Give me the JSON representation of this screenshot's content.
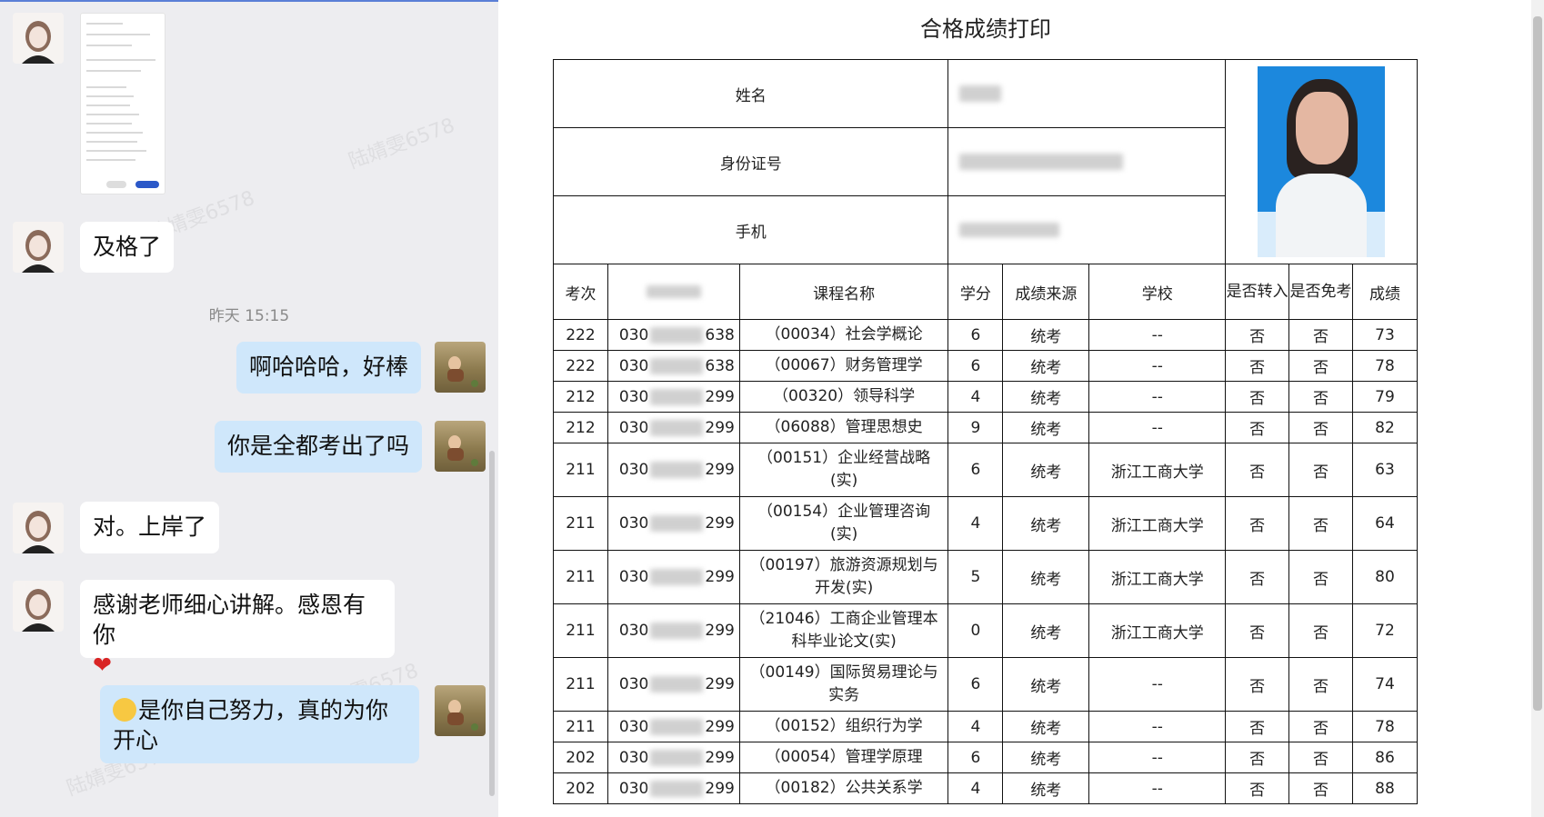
{
  "chat": {
    "timestamp": "昨天 15:15",
    "messages": [
      {
        "side": "in",
        "text": "及格了"
      },
      {
        "side": "out",
        "text": "啊哈哈哈，好棒"
      },
      {
        "side": "out",
        "text": "你是全都考出了吗"
      },
      {
        "side": "in",
        "text": "对。上岸了"
      },
      {
        "side": "in",
        "text": "感谢老师细心讲解。感恩有你",
        "emoji": "heart"
      },
      {
        "side": "out",
        "text": "是你自己努力，真的为你开心",
        "emoji": "wink"
      }
    ],
    "watermark": "陆婧雯6578"
  },
  "page": {
    "title": "合格成绩打印",
    "labels": {
      "name": "姓名",
      "id": "身份证号",
      "phone": "手机"
    },
    "headers": [
      "考次",
      "准考证号",
      "课程名称",
      "学分",
      "成绩来源",
      "学校",
      "是否转入",
      "是否免考",
      "成绩"
    ],
    "rows": [
      {
        "session": "222",
        "ticket_prefix": "030",
        "ticket_suffix": "638",
        "course": "（00034）社会学概论",
        "credit": "6",
        "source": "统考",
        "school": "--",
        "transfer": "否",
        "exempt": "否",
        "score": "73"
      },
      {
        "session": "222",
        "ticket_prefix": "030",
        "ticket_suffix": "638",
        "course": "（00067）财务管理学",
        "credit": "6",
        "source": "统考",
        "school": "--",
        "transfer": "否",
        "exempt": "否",
        "score": "78"
      },
      {
        "session": "212",
        "ticket_prefix": "030",
        "ticket_suffix": "299",
        "course": "（00320）领导科学",
        "credit": "4",
        "source": "统考",
        "school": "--",
        "transfer": "否",
        "exempt": "否",
        "score": "79"
      },
      {
        "session": "212",
        "ticket_prefix": "030",
        "ticket_suffix": "299",
        "course": "（06088）管理思想史",
        "credit": "9",
        "source": "统考",
        "school": "--",
        "transfer": "否",
        "exempt": "否",
        "score": "82"
      },
      {
        "session": "211",
        "ticket_prefix": "030",
        "ticket_suffix": "299",
        "course": "（00151）企业经营战略(实)",
        "credit": "6",
        "source": "统考",
        "school": "浙江工商大学",
        "transfer": "否",
        "exempt": "否",
        "score": "63"
      },
      {
        "session": "211",
        "ticket_prefix": "030",
        "ticket_suffix": "299",
        "course": "（00154）企业管理咨询(实)",
        "credit": "4",
        "source": "统考",
        "school": "浙江工商大学",
        "transfer": "否",
        "exempt": "否",
        "score": "64"
      },
      {
        "session": "211",
        "ticket_prefix": "030",
        "ticket_suffix": "299",
        "course": "（00197）旅游资源规划与开发(实)",
        "credit": "5",
        "source": "统考",
        "school": "浙江工商大学",
        "transfer": "否",
        "exempt": "否",
        "score": "80"
      },
      {
        "session": "211",
        "ticket_prefix": "030",
        "ticket_suffix": "299",
        "course": "（21046）工商企业管理本科毕业论文(实)",
        "credit": "0",
        "source": "统考",
        "school": "浙江工商大学",
        "transfer": "否",
        "exempt": "否",
        "score": "72"
      },
      {
        "session": "211",
        "ticket_prefix": "030",
        "ticket_suffix": "299",
        "course": "（00149）国际贸易理论与实务",
        "credit": "6",
        "source": "统考",
        "school": "--",
        "transfer": "否",
        "exempt": "否",
        "score": "74"
      },
      {
        "session": "211",
        "ticket_prefix": "030",
        "ticket_suffix": "299",
        "course": "（00152）组织行为学",
        "credit": "4",
        "source": "统考",
        "school": "--",
        "transfer": "否",
        "exempt": "否",
        "score": "78"
      },
      {
        "session": "202",
        "ticket_prefix": "030",
        "ticket_suffix": "299",
        "course": "（00054）管理学原理",
        "credit": "6",
        "source": "统考",
        "school": "--",
        "transfer": "否",
        "exempt": "否",
        "score": "86"
      },
      {
        "session": "202",
        "ticket_prefix": "030",
        "ticket_suffix": "299",
        "course": "（00182）公共关系学",
        "credit": "4",
        "source": "统考",
        "school": "--",
        "transfer": "否",
        "exempt": "否",
        "score": "88"
      }
    ]
  }
}
